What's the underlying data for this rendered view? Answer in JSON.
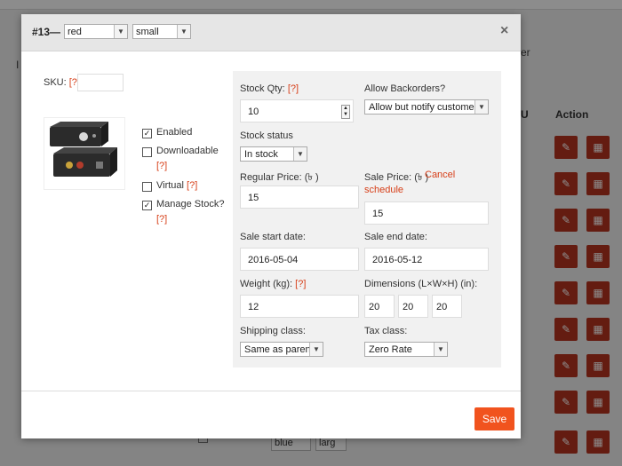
{
  "background": {
    "sub_text": "er",
    "column_sku": "U",
    "column_action": "Action",
    "letter": "I",
    "row_select_color": "blue",
    "row_select_size": "larg",
    "edit_icon": "pencil-icon",
    "delete_icon": "trash-icon"
  },
  "modal": {
    "id_label": "#13—",
    "color_select": "red",
    "size_select": "small",
    "close_glyph": "×",
    "sku_label": "SKU:",
    "help": "[?]",
    "enabled_label": "Enabled",
    "downloadable_label": "Downloadable",
    "virtual_label": "Virtual",
    "manage_stock_label": "Manage Stock?",
    "stock_qty_label": "Stock Qty:",
    "stock_qty_value": "10",
    "allow_backorders_label": "Allow Backorders?",
    "allow_backorders_value": "Allow but notify customer",
    "stock_status_label": "Stock status",
    "stock_status_value": "In stock",
    "regular_price_label": "Regular Price: (৳ )",
    "regular_price_value": "15",
    "sale_price_label": "Sale Price: (৳ )",
    "cancel_schedule": "Cancel schedule",
    "sale_price_value": "15",
    "sale_start_label": "Sale start date:",
    "sale_start_value": "2016-05-04",
    "sale_end_label": "Sale end date:",
    "sale_end_value": "2016-05-12",
    "weight_label": "Weight (kg):",
    "weight_value": "12",
    "dimensions_label": "Dimensions (L×W×H) (in):",
    "dim_l": "20",
    "dim_w": "20",
    "dim_h": "20",
    "shipping_class_label": "Shipping class:",
    "shipping_class_value": "Same as parent",
    "tax_class_label": "Tax class:",
    "tax_class_value": "Zero Rate",
    "save_label": "Save",
    "checkmark": "✓"
  },
  "colors": {
    "accent": "#f1531e",
    "help": "#d7401a",
    "delete_button": "#b7341f"
  }
}
